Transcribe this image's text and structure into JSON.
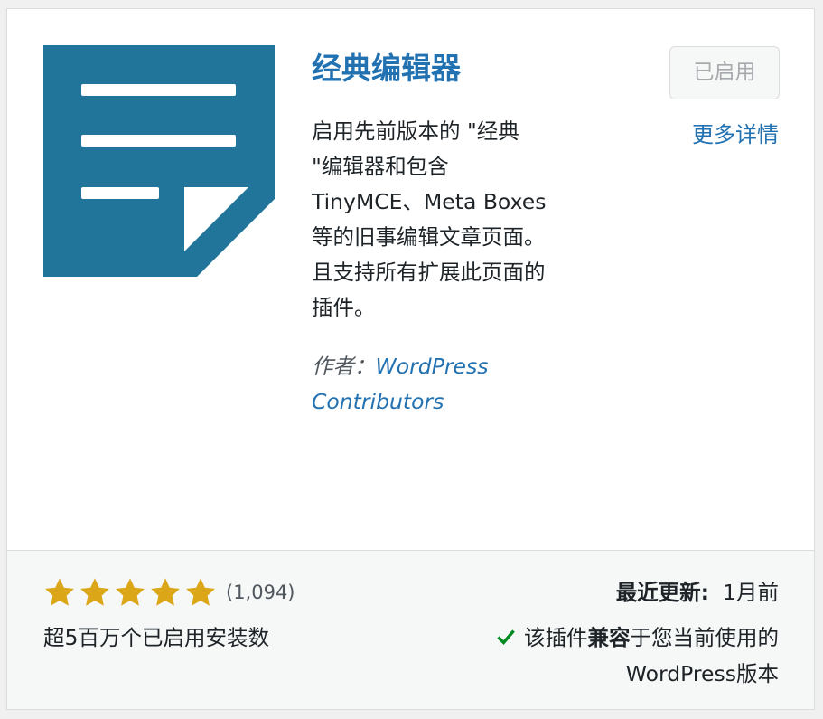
{
  "plugin": {
    "name": "经典编辑器",
    "description": "启用先前版本的 \"经典 \"编辑器和包含 TinyMCE、Meta Boxes 等的旧事编辑文章页面。且支持所有扩展此页面的插件。",
    "author_prefix": "作者：",
    "author_name": "WordPress Contributors",
    "active_button_label": "已启用",
    "more_details_label": "更多详情"
  },
  "footer": {
    "rating_value": 5,
    "rating_max": 5,
    "rating_count": "(1,094)",
    "installs": "超5百万个已启用安装数",
    "last_updated_label": "最近更新:",
    "last_updated_value": "1月前",
    "compat_before": "该插件",
    "compat_bold": "兼容",
    "compat_after": "于您当前使用的WordPress版本"
  },
  "colors": {
    "icon_blue": "#21759b",
    "link_blue": "#2271b1",
    "star_gold": "#dba617",
    "check_green": "#008a20"
  },
  "icons": {
    "plugin_icon": "document-icon",
    "star": "star-filled-icon",
    "check": "checkmark-icon"
  }
}
